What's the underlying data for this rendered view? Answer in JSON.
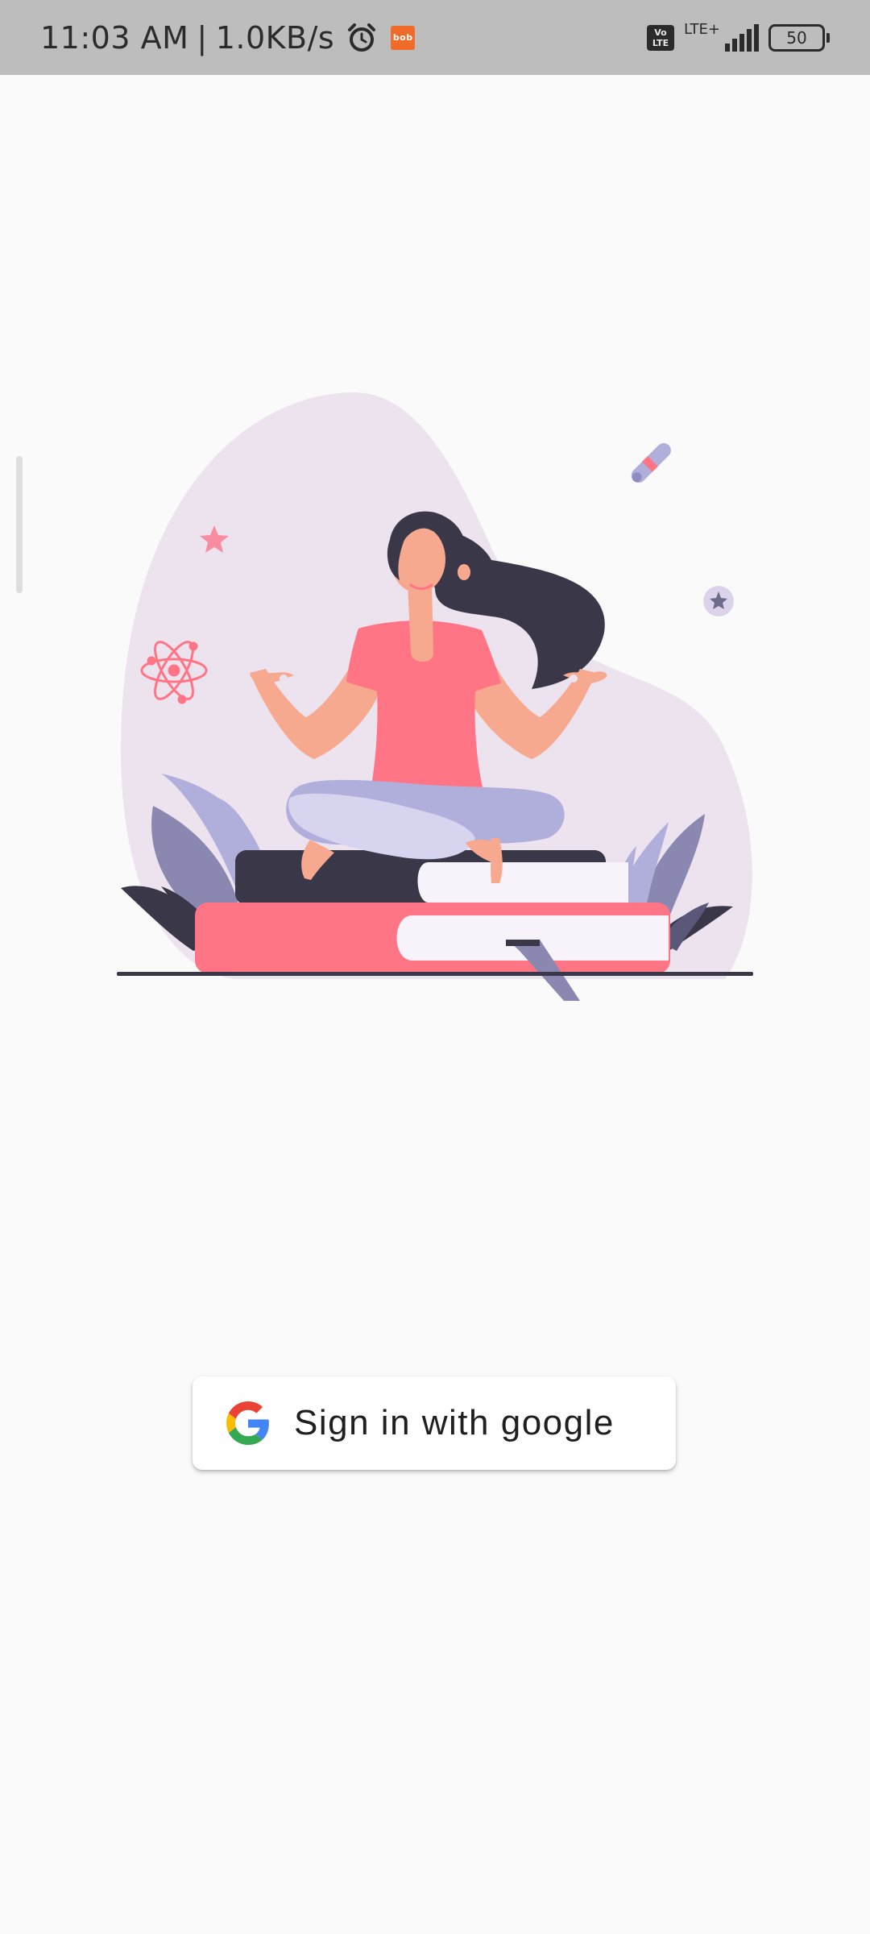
{
  "status_bar": {
    "time": "11:03 AM",
    "separator": "|",
    "network_speed": "1.0KB/s",
    "app_badge": "bob",
    "volte_label": "Vo\nLTE",
    "network_type": "LTE+",
    "battery_level": "50",
    "icons": [
      "alarm-icon",
      "bob-app-icon",
      "volte-icon",
      "signal-icon",
      "battery-icon"
    ]
  },
  "main": {
    "illustration": "meditation-illustration",
    "signin_button": {
      "label": "Sign in with google",
      "icon": "google-icon"
    }
  },
  "colors": {
    "background": "#fafafa",
    "status_bar": "#bdbdbd",
    "blob": "#ece3ef",
    "accent_pink": "#ff7585",
    "dark": "#3a3749",
    "lavender": "#b0aedb",
    "skin": "#f7a98f"
  }
}
